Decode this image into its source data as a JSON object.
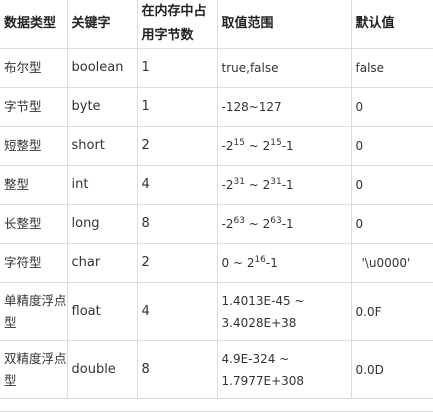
{
  "header": {
    "col_type": "数据类型",
    "col_keyword": "关键字",
    "col_bytes": "在内存中占用字节数",
    "col_range": "取值范围",
    "col_default": "默认值"
  },
  "rows": [
    {
      "type": "布尔型",
      "keyword": "boolean",
      "bytes": "1",
      "range_text": "true,false",
      "default": "false"
    },
    {
      "type": "字节型",
      "keyword": "byte",
      "bytes": "1",
      "range_text": "-128~127",
      "default": "0"
    },
    {
      "type": "短整型",
      "keyword": "short",
      "bytes": "2",
      "range_pre": "-2",
      "range_exp1": "15",
      "range_mid": " ~ 2",
      "range_exp2": "15",
      "range_post": "-1",
      "default": "0"
    },
    {
      "type": "整型",
      "keyword": "int",
      "bytes": "4",
      "range_pre": "-2",
      "range_exp1": "31",
      "range_mid": " ~ 2",
      "range_exp2": "31",
      "range_post": "-1",
      "default": "0"
    },
    {
      "type": "长整型",
      "keyword": "long",
      "bytes": "8",
      "range_pre": "-2",
      "range_exp1": "63",
      "range_mid": " ~ 2",
      "range_exp2": "63",
      "range_post": "-1",
      "default": "0"
    },
    {
      "type": "字符型",
      "keyword": "char",
      "bytes": "2",
      "range_pre": "0 ~ 2",
      "range_exp2": "16",
      "range_post": "-1",
      "default": "'\\u0000'"
    },
    {
      "type": "单精度浮点型",
      "keyword": "float",
      "bytes": "4",
      "range_line1": "1.4013E-45 ~",
      "range_line2": "3.4028E+38",
      "default": "0.0F"
    },
    {
      "type": "双精度浮点型",
      "keyword": "double",
      "bytes": "8",
      "range_line1": "4.9E-324 ~",
      "range_line2": "1.7977E+308",
      "default": "0.0D"
    }
  ]
}
